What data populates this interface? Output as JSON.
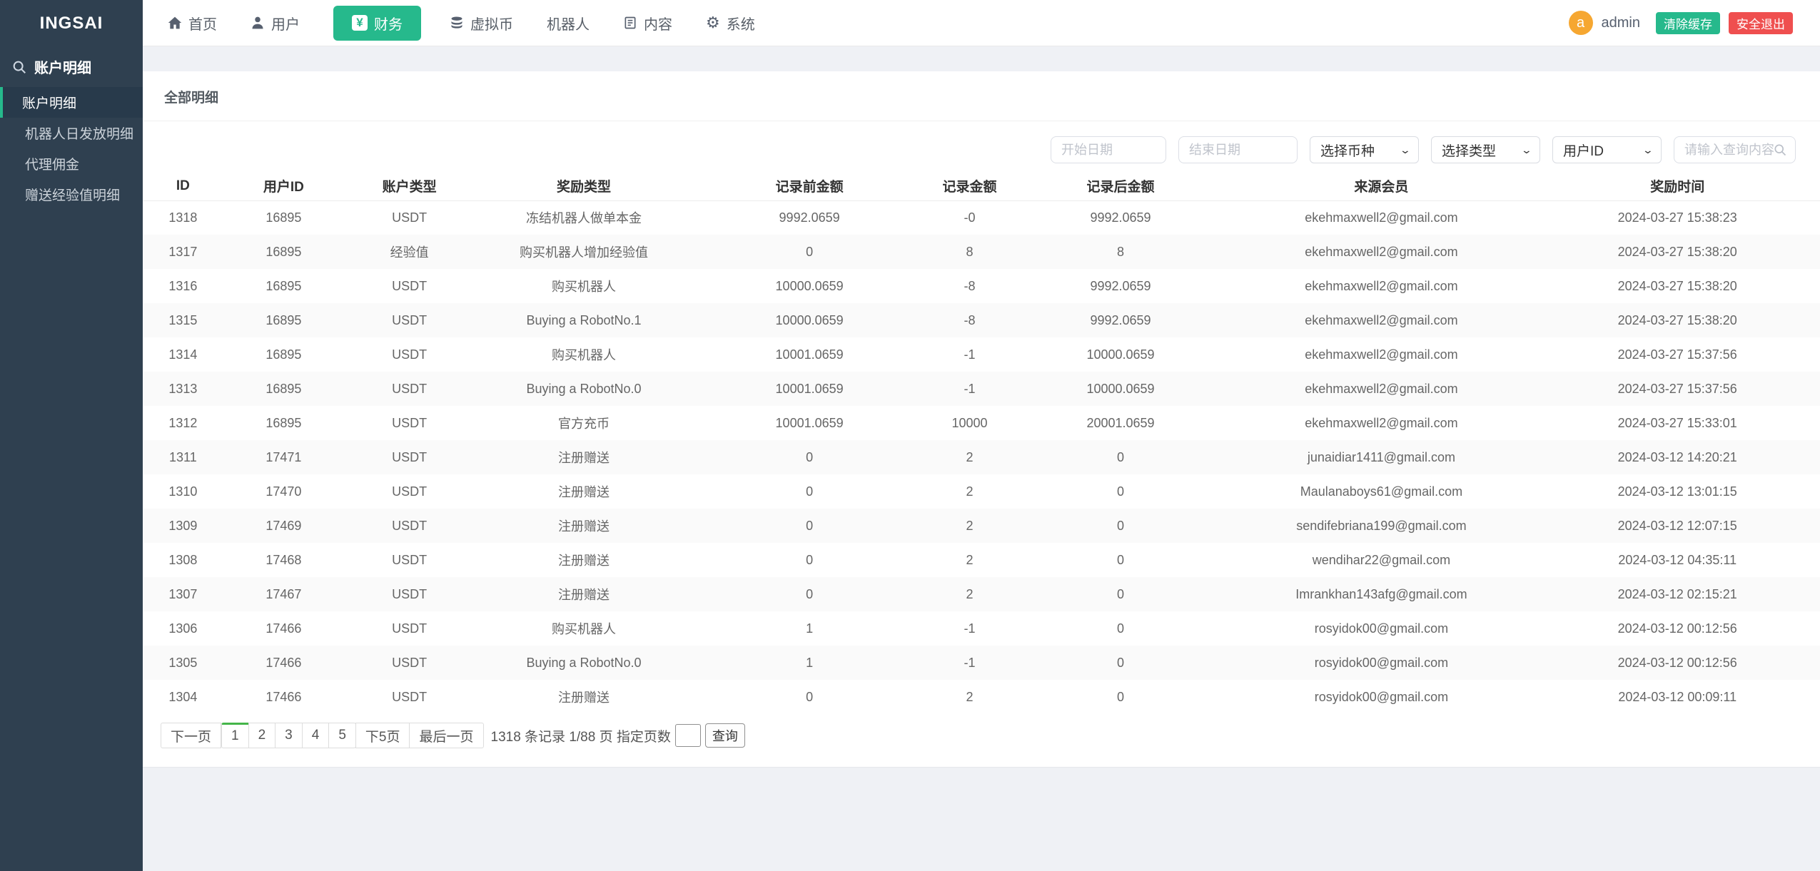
{
  "app": {
    "logo": "INGSAI"
  },
  "sidebar": {
    "section_label": "账户明细",
    "items": [
      {
        "label": "账户明细",
        "active": true
      },
      {
        "label": "机器人日发放明细",
        "active": false
      },
      {
        "label": "代理佣金",
        "active": false
      },
      {
        "label": "赠送经验值明细",
        "active": false
      }
    ]
  },
  "topnav": {
    "items": [
      {
        "label": "首页",
        "icon": "home-icon",
        "active": false
      },
      {
        "label": "用户",
        "icon": "user-icon",
        "active": false
      },
      {
        "label": "财务",
        "icon": "yen-icon",
        "active": true
      },
      {
        "label": "虚拟币",
        "icon": "coins-icon",
        "active": false
      },
      {
        "label": "机器人",
        "icon": "",
        "active": false
      },
      {
        "label": "内容",
        "icon": "document-icon",
        "active": false
      },
      {
        "label": "系统",
        "icon": "gear-icon",
        "active": false
      }
    ]
  },
  "userbar": {
    "avatar_letter": "a",
    "username": "admin",
    "clear_cache_label": "清除缓存",
    "logout_label": "安全退出"
  },
  "panel": {
    "title": "全部明细"
  },
  "filters": {
    "start_date_placeholder": "开始日期",
    "end_date_placeholder": "结束日期",
    "coin_select_value": "选择币种",
    "type_select_value": "选择类型",
    "user_select_value": "用户ID",
    "search_placeholder": "请输入查询内容"
  },
  "table": {
    "headers": [
      "ID",
      "用户ID",
      "账户类型",
      "奖励类型",
      "记录前金额",
      "记录金额",
      "记录后金额",
      "来源会员",
      "奖励时间"
    ],
    "rows": [
      [
        "1318",
        "16895",
        "USDT",
        "冻结机器人做单本金",
        "9992.0659",
        "-0",
        "9992.0659",
        "ekehmaxwell2@gmail.com",
        "2024-03-27 15:38:23"
      ],
      [
        "1317",
        "16895",
        "经验值",
        "购买机器人增加经验值",
        "0",
        "8",
        "8",
        "ekehmaxwell2@gmail.com",
        "2024-03-27 15:38:20"
      ],
      [
        "1316",
        "16895",
        "USDT",
        "购买机器人",
        "10000.0659",
        "-8",
        "9992.0659",
        "ekehmaxwell2@gmail.com",
        "2024-03-27 15:38:20"
      ],
      [
        "1315",
        "16895",
        "USDT",
        "Buying a RobotNo.1",
        "10000.0659",
        "-8",
        "9992.0659",
        "ekehmaxwell2@gmail.com",
        "2024-03-27 15:38:20"
      ],
      [
        "1314",
        "16895",
        "USDT",
        "购买机器人",
        "10001.0659",
        "-1",
        "10000.0659",
        "ekehmaxwell2@gmail.com",
        "2024-03-27 15:37:56"
      ],
      [
        "1313",
        "16895",
        "USDT",
        "Buying a RobotNo.0",
        "10001.0659",
        "-1",
        "10000.0659",
        "ekehmaxwell2@gmail.com",
        "2024-03-27 15:37:56"
      ],
      [
        "1312",
        "16895",
        "USDT",
        "官方充币",
        "10001.0659",
        "10000",
        "20001.0659",
        "ekehmaxwell2@gmail.com",
        "2024-03-27 15:33:01"
      ],
      [
        "1311",
        "17471",
        "USDT",
        "注册赠送",
        "0",
        "2",
        "0",
        "junaidiar1411@gmail.com",
        "2024-03-12 14:20:21"
      ],
      [
        "1310",
        "17470",
        "USDT",
        "注册赠送",
        "0",
        "2",
        "0",
        "Maulanaboys61@gmail.com",
        "2024-03-12 13:01:15"
      ],
      [
        "1309",
        "17469",
        "USDT",
        "注册赠送",
        "0",
        "2",
        "0",
        "sendifebriana199@gmail.com",
        "2024-03-12 12:07:15"
      ],
      [
        "1308",
        "17468",
        "USDT",
        "注册赠送",
        "0",
        "2",
        "0",
        "wendihar22@gmail.com",
        "2024-03-12 04:35:11"
      ],
      [
        "1307",
        "17467",
        "USDT",
        "注册赠送",
        "0",
        "2",
        "0",
        "Imrankhan143afg@gmail.com",
        "2024-03-12 02:15:21"
      ],
      [
        "1306",
        "17466",
        "USDT",
        "购买机器人",
        "1",
        "-1",
        "0",
        "rosyidok00@gmail.com",
        "2024-03-12 00:12:56"
      ],
      [
        "1305",
        "17466",
        "USDT",
        "Buying a RobotNo.0",
        "1",
        "-1",
        "0",
        "rosyidok00@gmail.com",
        "2024-03-12 00:12:56"
      ],
      [
        "1304",
        "17466",
        "USDT",
        "注册赠送",
        "0",
        "2",
        "0",
        "rosyidok00@gmail.com",
        "2024-03-12 00:09:11"
      ]
    ]
  },
  "pagination": {
    "prev_label": "下一页",
    "pages": [
      "1",
      "2",
      "3",
      "4",
      "5"
    ],
    "active_page": "1",
    "next5_label": "下5页",
    "last_label": "最后一页",
    "summary": "1318 条记录 1/88 页 指定页数",
    "goto_value": "",
    "query_label": "查询"
  },
  "colors": {
    "accent_green": "#26b98c",
    "logout_red": "#ef4f4f",
    "avatar_orange": "#f6a731",
    "pagination_active_green": "#44b549",
    "sidebar_bg": "#2f4050"
  }
}
